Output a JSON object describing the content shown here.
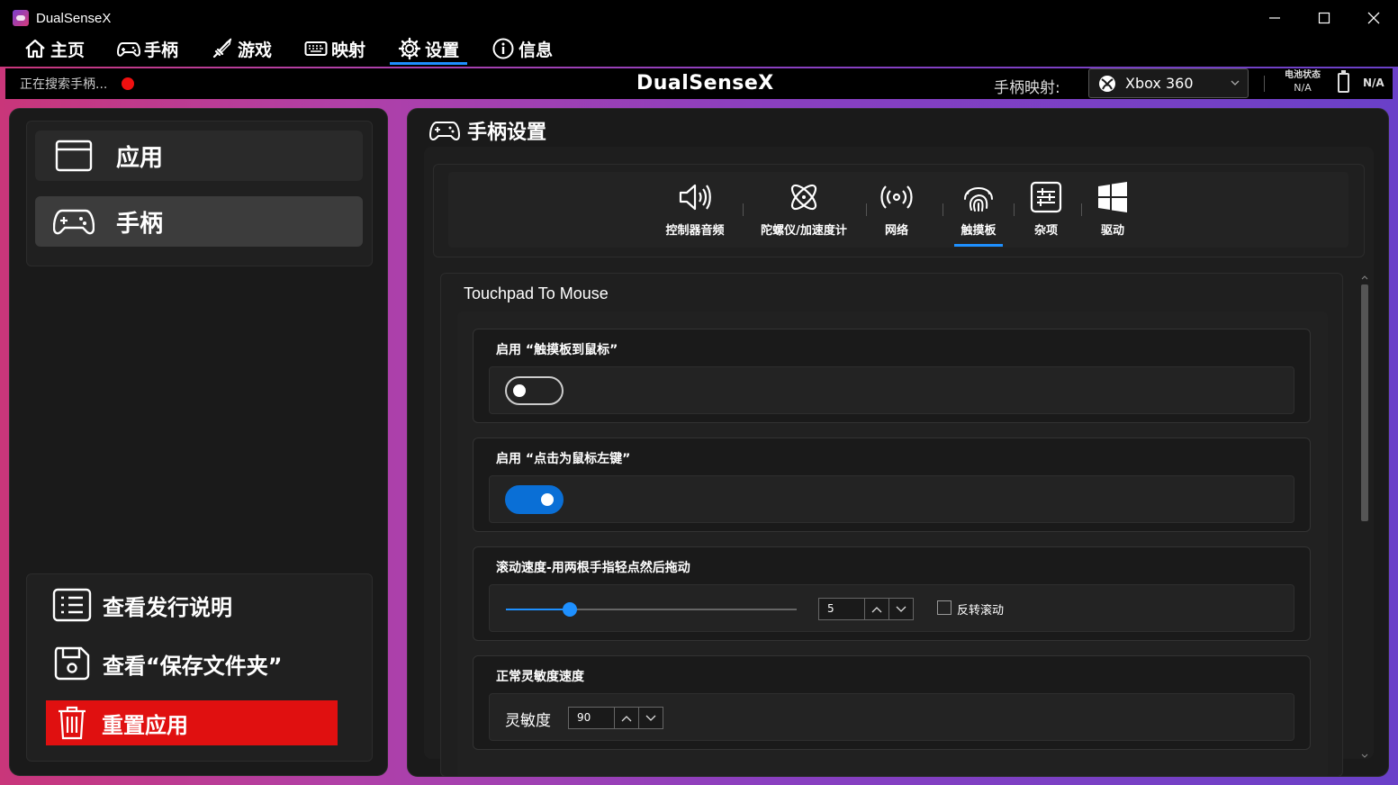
{
  "window": {
    "title": "DualSenseX"
  },
  "nav": [
    {
      "label": "主页",
      "icon": "home-icon"
    },
    {
      "label": "手柄",
      "icon": "gamepad-icon"
    },
    {
      "label": "游戏",
      "icon": "sword-icon"
    },
    {
      "label": "映射",
      "icon": "keyboard-icon"
    },
    {
      "label": "设置",
      "icon": "gear-icon",
      "active": true
    },
    {
      "label": "信息",
      "icon": "info-icon"
    }
  ],
  "status": {
    "search_text": "正在搜索手柄...",
    "brand": "DualSenseX",
    "mapping_label": "手柄映射:",
    "mapping_value": "Xbox 360",
    "battery_label": "电池状态",
    "battery_value": "N/A",
    "controller_battery": "N/A"
  },
  "sidebar": {
    "items": [
      {
        "label": "应用",
        "icon": "window-icon"
      },
      {
        "label": "手柄",
        "icon": "gamepad-icon",
        "active": true
      }
    ],
    "links": [
      {
        "label": "查看发行说明",
        "icon": "list-icon"
      },
      {
        "label": "查看“保存文件夹”",
        "icon": "save-icon"
      }
    ],
    "reset_label": "重置应用"
  },
  "panel": {
    "title": "手柄设置",
    "tabs": [
      {
        "label": "控制器音频",
        "icon": "speaker-icon"
      },
      {
        "label": "陀螺仪/加速度计",
        "icon": "gyro-icon"
      },
      {
        "label": "网络",
        "icon": "network-icon"
      },
      {
        "label": "触摸板",
        "icon": "fingerprint-icon",
        "active": true
      },
      {
        "label": "杂项",
        "icon": "sliders-icon"
      },
      {
        "label": "驱动",
        "icon": "windows-icon"
      }
    ],
    "section_title": "Touchpad To Mouse",
    "settings": {
      "enable_touchpad": {
        "label": "启用 “触摸板到鼠标”",
        "on": false
      },
      "tap_left_click": {
        "label": "启用 “点击为鼠标左键”",
        "on": true
      },
      "scroll_speed": {
        "label": "滚动速度-用两根手指轻点然后拖动",
        "value": "5",
        "slider_fraction": 0.22,
        "invert_label": "反转滚动",
        "invert_checked": false
      },
      "sensitivity": {
        "label": "正常灵敏度速度",
        "field_label": "灵敏度",
        "value": "90"
      }
    }
  },
  "colors": {
    "accent": "#1e90ff",
    "danger": "#e01010",
    "toggle_on": "#0a6fd6"
  }
}
